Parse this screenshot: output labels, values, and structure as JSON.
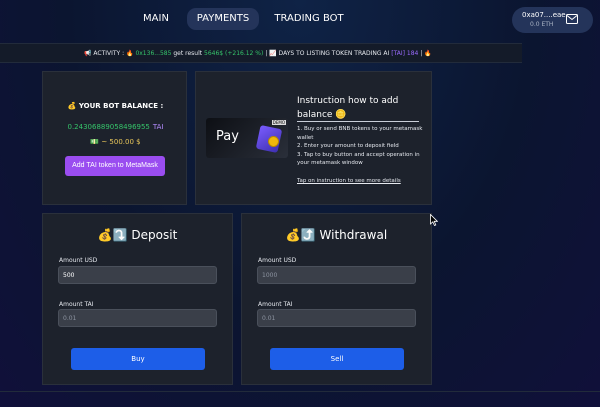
{
  "nav": {
    "main_label": "MAIN",
    "payments_label": "PAYMENTS",
    "trading_label": "TRADING BOT"
  },
  "wallet": {
    "address": "0xa07....eae",
    "balance": "0.0 ETH",
    "icon": "mail-icon"
  },
  "ticker": {
    "prefix": "📢 ACTIVITY : 🔥",
    "address": "0x136...585",
    "mid_text": "get result",
    "result": "5646$ (+216.12 %)",
    "countdown_text": "| 📈 DAYS TO LISTING TOKEN TRADING AI",
    "tag": "[TAI]",
    "days": "184",
    "suffix": "| 🔥"
  },
  "balance": {
    "title": "💰 YOUR BOT BALANCE :",
    "amount": "0.24306889058496955",
    "unit": "TAI",
    "usd": "💵 ~ 500.00 $",
    "add_button": "Add TAI token to MetaMask"
  },
  "instruction": {
    "title": "Instruction how to add balance 🪙",
    "pay_label": " Pay",
    "pay_tag": "DEMO",
    "steps": [
      "1. Buy or send BNB tokens to your metamask wallet",
      "2. Enter your amount to deposit field",
      "3. Tap to buy button and accept operation in your metamask window"
    ],
    "link": "Tap on instruction to see more details"
  },
  "deposit": {
    "title": "💰⤵️ Deposit",
    "amount_usd_label": "Amount USD",
    "amount_usd_value": "500",
    "amount_tai_label": "Amount TAI",
    "amount_tai_placeholder": "0.01",
    "button": "Buy"
  },
  "withdrawal": {
    "title": "💰⤴️ Withdrawal",
    "amount_usd_label": "Amount USD",
    "amount_usd_placeholder": "1000",
    "amount_tai_label": "Amount TAI",
    "amount_tai_placeholder": "0.01",
    "button": "Sell"
  },
  "colors": {
    "accent_green": "#35c46a",
    "accent_purple": "#9a4df0",
    "button_blue": "#1d5ee8"
  }
}
